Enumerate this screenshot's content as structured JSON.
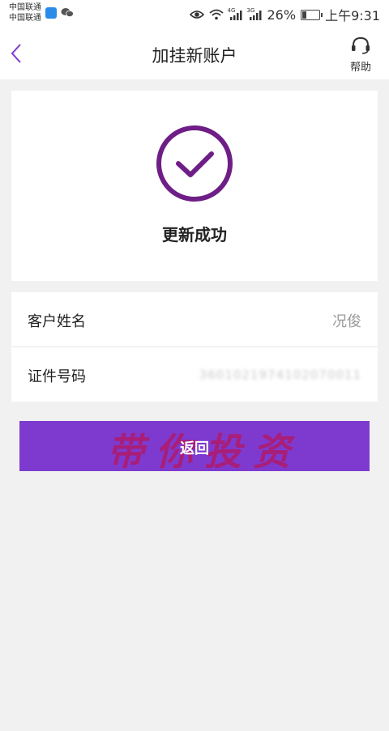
{
  "status_bar": {
    "carrier_1": "中国联通",
    "carrier_2": "中国联通",
    "network_1": "4G",
    "network_2": "3G",
    "battery_text": "26%",
    "battery_level": 0.26,
    "time": "上午9:31"
  },
  "header": {
    "title": "加挂新账户",
    "help_label": "帮助"
  },
  "success": {
    "message": "更新成功"
  },
  "info": {
    "rows": [
      {
        "label": "客户姓名",
        "value": "况俊"
      },
      {
        "label": "证件号码",
        "value": "3601021974102070011"
      }
    ]
  },
  "actions": {
    "return_label": "返回"
  },
  "watermark": "带你投资",
  "colors": {
    "accent": "#7e3acf",
    "check_circle": "#6e1e86",
    "watermark": "#b01a6a"
  }
}
